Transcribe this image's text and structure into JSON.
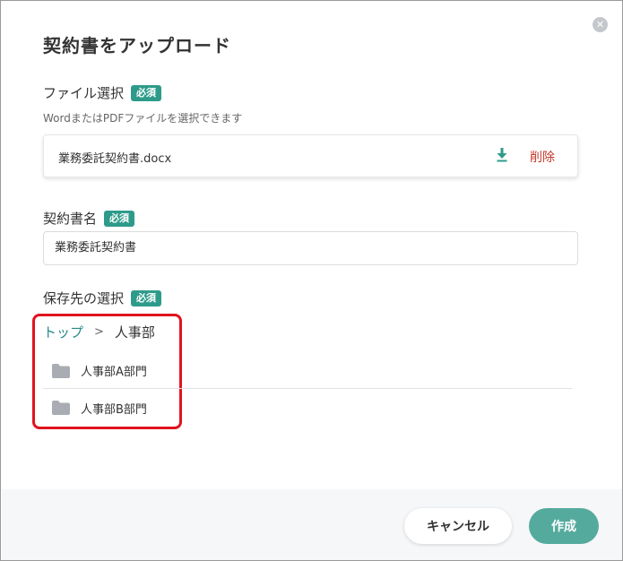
{
  "dialog": {
    "title": "契約書をアップロード",
    "close_icon": "close-icon"
  },
  "file_select": {
    "label": "ファイル選択",
    "required_badge": "必須",
    "hint": "WordまたはPDFファイルを選択できます",
    "file_name": "業務委託契約書.docx",
    "download_icon": "download-icon",
    "delete_label": "削除"
  },
  "contract_name": {
    "label": "契約書名",
    "required_badge": "必須",
    "value": "業務委託契約書"
  },
  "destination": {
    "label": "保存先の選択",
    "required_badge": "必須",
    "breadcrumb": {
      "top": "トップ",
      "separator": ">",
      "current": "人事部"
    },
    "folders": [
      {
        "label": "人事部A部門",
        "icon": "folder-icon"
      },
      {
        "label": "人事部B部門",
        "icon": "folder-icon"
      }
    ]
  },
  "footer": {
    "cancel_label": "キャンセル",
    "create_label": "作成"
  },
  "colors": {
    "accent": "#2e9b8a",
    "create_button": "#55aa9e",
    "delete": "#c0392b",
    "highlight": "#e0141e",
    "link": "#2a8a86"
  }
}
